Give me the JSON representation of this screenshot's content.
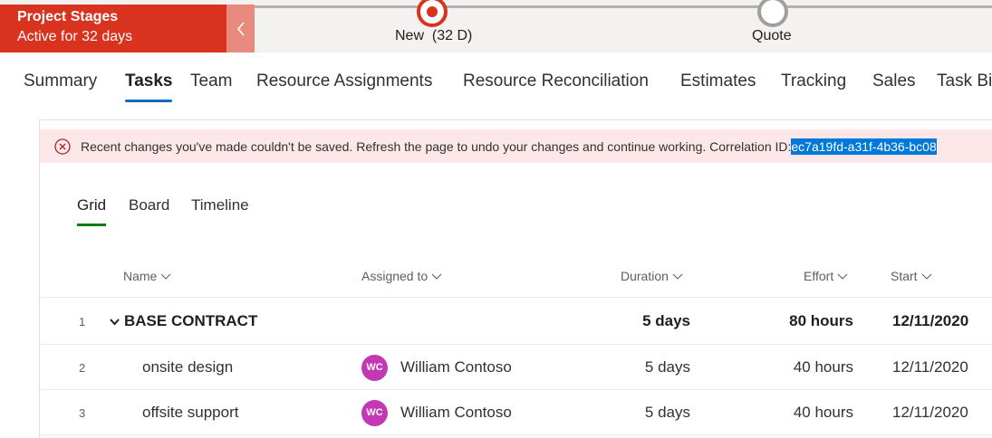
{
  "stage_panel": {
    "title": "Project Stages",
    "subtitle": "Active for 32 days",
    "stages": [
      {
        "label": "New",
        "duration": "(32 D)",
        "state": "active"
      },
      {
        "label": "Quote",
        "state": "upcoming"
      }
    ]
  },
  "colors": {
    "stage_accent": "#d9321f",
    "tab_underline": "#0f6cbd",
    "subtab_underline": "#107c10",
    "error_background": "#fde7e9",
    "avatar": "#c239b3"
  },
  "main_tabs": [
    "Summary",
    "Tasks",
    "Team",
    "Resource Assignments",
    "Resource Reconciliation",
    "Estimates",
    "Tracking",
    "Sales",
    "Task Bil"
  ],
  "active_main_tab": "Tasks",
  "error": {
    "icon": "error-circle-icon",
    "message": "Recent changes you've made couldn't be saved. Refresh the page to undo your changes and continue working.  Correlation ID: ",
    "correlation_id": "ec7a19fd-a31f-4b36-bc08"
  },
  "view_tabs": [
    "Grid",
    "Board",
    "Timeline"
  ],
  "active_view_tab": "Grid",
  "grid": {
    "columns": [
      "Name",
      "Assigned to",
      "Duration",
      "Effort",
      "Start"
    ],
    "rows": [
      {
        "num": "1",
        "name": "BASE CONTRACT",
        "summary": true,
        "assigned": "",
        "initials": "",
        "duration": "5 days",
        "effort": "80 hours",
        "start": "12/11/2020"
      },
      {
        "num": "2",
        "name": "onsite design",
        "summary": false,
        "assigned": "William Contoso",
        "initials": "WC",
        "duration": "5 days",
        "effort": "40 hours",
        "start": "12/11/2020"
      },
      {
        "num": "3",
        "name": "offsite support",
        "summary": false,
        "assigned": "William Contoso",
        "initials": "WC",
        "duration": "5 days",
        "effort": "40 hours",
        "start": "12/11/2020"
      }
    ]
  }
}
